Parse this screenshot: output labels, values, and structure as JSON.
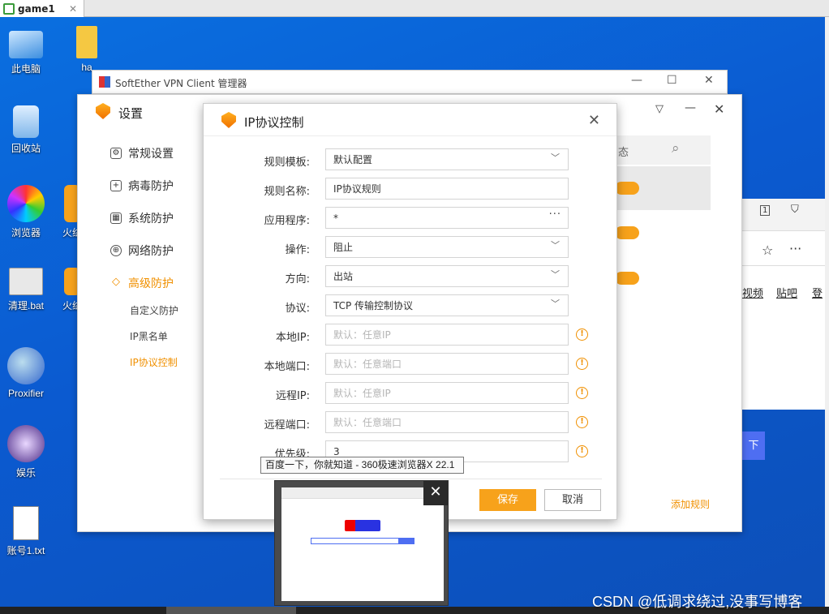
{
  "taskbar_tab": {
    "label": "game1",
    "close": "✕"
  },
  "desktop_icons": [
    {
      "label": "此电脑"
    },
    {
      "label": "ha"
    },
    {
      "label": "回收站"
    },
    {
      "label": "浏览器"
    },
    {
      "label": "火绒"
    },
    {
      "label": "清理.bat"
    },
    {
      "label": "火绒"
    },
    {
      "label": "Proxifier"
    },
    {
      "label": "娱乐"
    },
    {
      "label": "账号1.txt"
    }
  ],
  "softether": {
    "title": "SoftEther VPN Client 管理器",
    "minimize": "—",
    "maximize": "☐",
    "close": "✕"
  },
  "settings": {
    "title": "设置",
    "nav": {
      "general": "常规设置",
      "virus": "病毒防护",
      "system": "系统防护",
      "network": "网络防护",
      "advanced": "高级防护"
    },
    "sub": {
      "custom": "自定义防护",
      "ip_blacklist": "IP黑名单",
      "ip_protocol": "IP协议控制"
    },
    "status_fragment": "态",
    "add_rule": "添加规则"
  },
  "dialog": {
    "title": "IP协议控制",
    "close": "✕",
    "rows": {
      "template": {
        "label": "规则模板:",
        "value": "默认配置"
      },
      "name": {
        "label": "规则名称:",
        "value": "IP协议规则"
      },
      "app": {
        "label": "应用程序:",
        "value": "*",
        "more": "···"
      },
      "action": {
        "label": "操作:",
        "value": "阻止"
      },
      "direction": {
        "label": "方向:",
        "value": "出站"
      },
      "protocol": {
        "label": "协议:",
        "value": "TCP 传输控制协议"
      },
      "local_ip": {
        "label": "本地IP:",
        "placeholder": "默认：任意IP"
      },
      "local_port": {
        "label": "本地端口:",
        "placeholder": "默认：任意端口"
      },
      "remote_ip": {
        "label": "远程IP:",
        "placeholder": "默认：任意IP"
      },
      "remote_port": {
        "label": "远程端口:",
        "placeholder": "默认：任意端口"
      },
      "priority": {
        "label": "优先级:",
        "value": "3"
      }
    },
    "save": "保存",
    "cancel": "取消"
  },
  "tooltip": "百度一下，你就知道 - 360极速浏览器X 22.1",
  "browser_fragment": {
    "tab_num": "1",
    "link1": "视频",
    "link2": "贴吧",
    "link3": "登",
    "btn": "下"
  },
  "watermark": "CSDN @低调求绕过,没事写博客",
  "colors": {
    "accent": "#f7a21b",
    "desktop": "#0b5ad0"
  }
}
